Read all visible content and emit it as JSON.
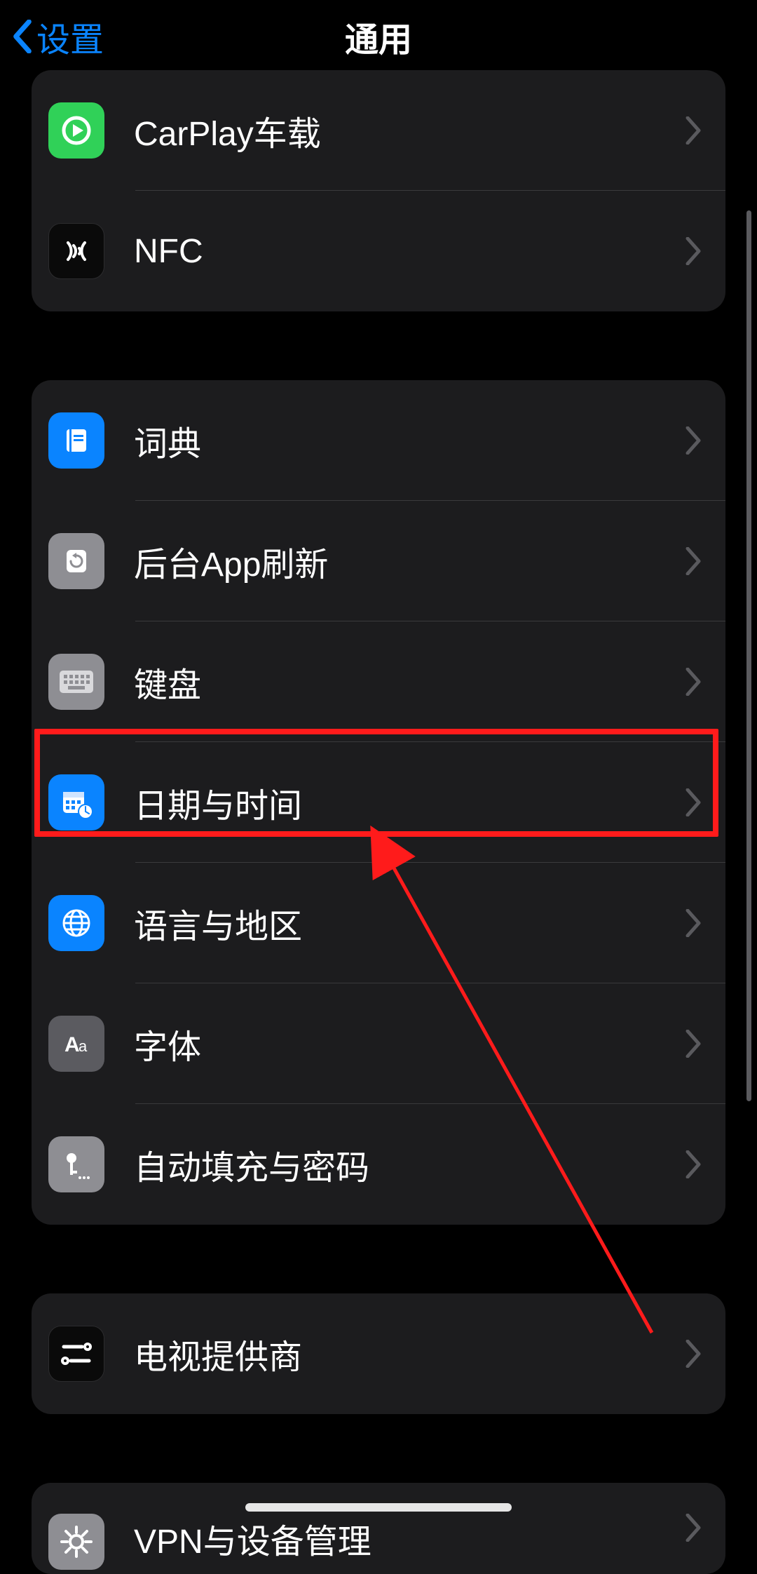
{
  "header": {
    "back_label": "设置",
    "title": "通用"
  },
  "groups": [
    {
      "rows": [
        {
          "id": "carplay",
          "label": "CarPlay车载",
          "icon_name": "carplay-icon",
          "icon_bg": "bg-green"
        },
        {
          "id": "nfc",
          "label": "NFC",
          "icon_name": "nfc-icon",
          "icon_bg": "bg-black"
        }
      ]
    },
    {
      "rows": [
        {
          "id": "dictionary",
          "label": "词典",
          "icon_name": "dictionary-icon",
          "icon_bg": "bg-blue"
        },
        {
          "id": "bg-app-refresh",
          "label": "后台App刷新",
          "icon_name": "refresh-icon",
          "icon_bg": "bg-gray"
        },
        {
          "id": "keyboard",
          "label": "键盘",
          "icon_name": "keyboard-icon",
          "icon_bg": "bg-gray"
        },
        {
          "id": "date-time",
          "label": "日期与时间",
          "icon_name": "date-time-icon",
          "icon_bg": "bg-blue",
          "highlighted": true
        },
        {
          "id": "language-region",
          "label": "语言与地区",
          "icon_name": "globe-icon",
          "icon_bg": "bg-blue"
        },
        {
          "id": "fonts",
          "label": "字体",
          "icon_name": "fonts-icon",
          "icon_bg": "bg-dgray"
        },
        {
          "id": "autofill",
          "label": "自动填充与密码",
          "icon_name": "key-icon",
          "icon_bg": "bg-gray"
        }
      ]
    },
    {
      "rows": [
        {
          "id": "tv-provider",
          "label": "电视提供商",
          "icon_name": "tv-provider-icon",
          "icon_bg": "bg-black"
        }
      ]
    },
    {
      "rows": [
        {
          "id": "vpn-device-mgmt",
          "label": "VPN与设备管理",
          "icon_name": "gear-icon",
          "icon_bg": "bg-gray"
        }
      ]
    }
  ],
  "annotation": {
    "highlight_color": "#ff1b1b",
    "arrow_color": "#ff1b1b"
  }
}
